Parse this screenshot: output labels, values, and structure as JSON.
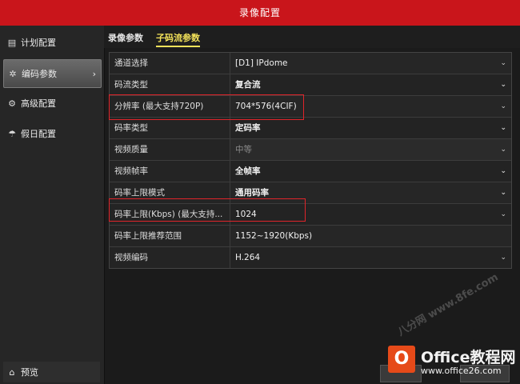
{
  "window": {
    "title": "录像配置"
  },
  "sidebar": {
    "items": [
      {
        "label": "计划配置",
        "icon": "calendar-icon",
        "active": false
      },
      {
        "label": "编码参数",
        "icon": "gear-icon",
        "active": true
      },
      {
        "label": "高级配置",
        "icon": "settings-icon",
        "active": false
      },
      {
        "label": "假日配置",
        "icon": "umbrella-icon",
        "active": false
      }
    ],
    "bottom": {
      "label": "预览",
      "icon": "home-icon"
    }
  },
  "tabs": [
    {
      "label": "录像参数",
      "active": false
    },
    {
      "label": "子码流参数",
      "active": true
    }
  ],
  "form": {
    "rows": [
      {
        "label": "通道选择",
        "value": "[D1] IPdome",
        "dropdown": true
      },
      {
        "label": "码流类型",
        "value": "复合流",
        "dropdown": true
      },
      {
        "label": "分辨率 (最大支持720P)",
        "value": "704*576(4CIF)",
        "dropdown": true
      },
      {
        "label": "码率类型",
        "value": "定码率",
        "dropdown": true
      },
      {
        "label": "视频质量",
        "value": "中等",
        "dropdown": true
      },
      {
        "label": "视频帧率",
        "value": "全帧率",
        "dropdown": true
      },
      {
        "label": "码率上限模式",
        "value": "通用码率",
        "dropdown": true
      },
      {
        "label": "码率上限(Kbps) (最大支持...",
        "value": "1024",
        "dropdown": true
      },
      {
        "label": "码率上限推荐范围",
        "value": "1152~1920(Kbps)",
        "dropdown": false
      },
      {
        "label": "视频编码",
        "value": "H.264",
        "dropdown": true
      }
    ]
  },
  "watermark": {
    "text": "八分网 www.8fe.com"
  },
  "logo": {
    "badge": "O",
    "name": "Office教程网",
    "url": "www.office26.com"
  },
  "colors": {
    "titlebar": "#c9151b",
    "highlight": "#e0242a",
    "active_tab": "#f3e25a"
  }
}
